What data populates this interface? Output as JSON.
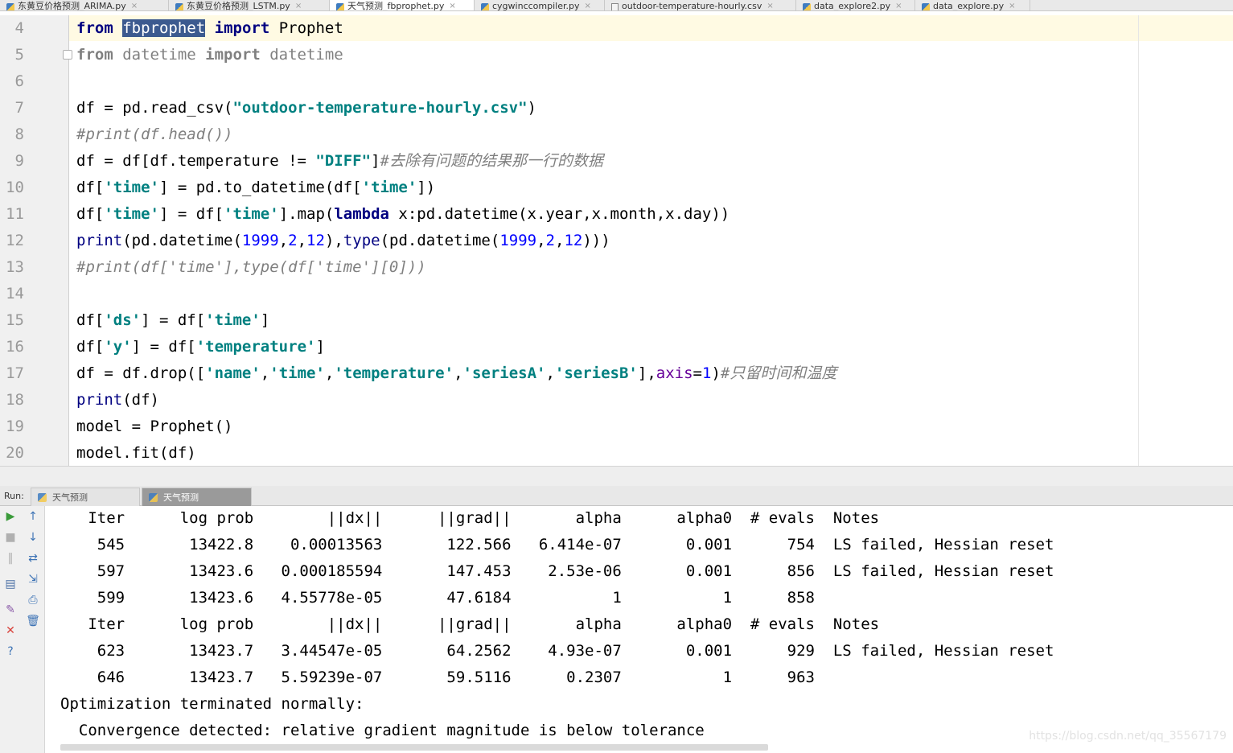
{
  "tabs": [
    {
      "label": "东黄豆价格预测_ARIMA.py",
      "icon": "python-file-icon",
      "active": false
    },
    {
      "label": "东黄豆价格预测_LSTM.py",
      "icon": "python-file-icon",
      "active": false
    },
    {
      "label": "天气预测_fbprophet.py",
      "icon": "python-file-icon",
      "active": true
    },
    {
      "label": "cygwinccompiler.py",
      "icon": "python-file-icon",
      "active": false
    },
    {
      "label": "outdoor-temperature-hourly.csv",
      "icon": "csv-file-icon",
      "active": false
    },
    {
      "label": "data_explore2.py",
      "icon": "python-file-icon",
      "active": false
    },
    {
      "label": "data_explore.py",
      "icon": "python-file-icon",
      "active": false
    }
  ],
  "tab_close_glyph": "×",
  "editor": {
    "caret_line": "4",
    "lines": [
      {
        "n": "4",
        "t": [
          [
            "from",
            "kw"
          ],
          [
            " ",
            ""
          ],
          [
            "fbprophet",
            "sel"
          ],
          [
            " ",
            ""
          ],
          [
            "import",
            "kw"
          ],
          [
            " Prophet",
            ""
          ]
        ]
      },
      {
        "n": "5",
        "fold": true,
        "t": [
          [
            "from",
            "unused-kw"
          ],
          [
            " datetime ",
            "unused"
          ],
          [
            "import",
            "unused-kw"
          ],
          [
            " datetime",
            "unused"
          ]
        ]
      },
      {
        "n": "6",
        "t": []
      },
      {
        "n": "7",
        "t": [
          [
            "df = pd.read_csv(",
            ""
          ],
          [
            "\"outdoor-temperature-hourly.csv\"",
            "str"
          ],
          [
            ")",
            ""
          ]
        ]
      },
      {
        "n": "8",
        "t": [
          [
            "#print(df.head())",
            "cmt"
          ]
        ]
      },
      {
        "n": "9",
        "t": [
          [
            "df = df[df.temperature != ",
            ""
          ],
          [
            "\"DIFF\"",
            "str"
          ],
          [
            "]",
            ""
          ],
          [
            "#去除有问题的结果那一行的数据",
            "cmt"
          ]
        ]
      },
      {
        "n": "10",
        "t": [
          [
            "df[",
            ""
          ],
          [
            "'time'",
            "str"
          ],
          [
            "] = pd.to_datetime(df[",
            ""
          ],
          [
            "'time'",
            "str"
          ],
          [
            "])",
            ""
          ]
        ]
      },
      {
        "n": "11",
        "t": [
          [
            "df[",
            ""
          ],
          [
            "'time'",
            "str"
          ],
          [
            "] = df[",
            ""
          ],
          [
            "'time'",
            "str"
          ],
          [
            "].map(",
            ""
          ],
          [
            "lambda",
            "kw"
          ],
          [
            " x:pd.datetime(x.year,x.month,x.day))",
            ""
          ]
        ]
      },
      {
        "n": "12",
        "t": [
          [
            "print",
            "bi"
          ],
          [
            "(pd.datetime(",
            ""
          ],
          [
            "1999",
            "num"
          ],
          [
            ",",
            ""
          ],
          [
            "2",
            "num"
          ],
          [
            ",",
            ""
          ],
          [
            "12",
            "num"
          ],
          [
            "),",
            ""
          ],
          [
            "type",
            "bi"
          ],
          [
            "(pd.datetime(",
            ""
          ],
          [
            "1999",
            "num"
          ],
          [
            ",",
            ""
          ],
          [
            "2",
            "num"
          ],
          [
            ",",
            ""
          ],
          [
            "12",
            "num"
          ],
          [
            ")))",
            ""
          ]
        ]
      },
      {
        "n": "13",
        "t": [
          [
            "#print(df['time'],type(df['time'][0]))",
            "cmt"
          ]
        ]
      },
      {
        "n": "14",
        "t": []
      },
      {
        "n": "15",
        "t": [
          [
            "df[",
            ""
          ],
          [
            "'ds'",
            "str"
          ],
          [
            "] = df[",
            ""
          ],
          [
            "'time'",
            "str"
          ],
          [
            "]",
            ""
          ]
        ]
      },
      {
        "n": "16",
        "t": [
          [
            "df[",
            ""
          ],
          [
            "'y'",
            "str"
          ],
          [
            "] = df[",
            ""
          ],
          [
            "'temperature'",
            "str"
          ],
          [
            "]",
            ""
          ]
        ]
      },
      {
        "n": "17",
        "t": [
          [
            "df = df.drop([",
            ""
          ],
          [
            "'name'",
            "str"
          ],
          [
            ",",
            ""
          ],
          [
            "'time'",
            "str"
          ],
          [
            ",",
            ""
          ],
          [
            "'temperature'",
            "str"
          ],
          [
            ",",
            ""
          ],
          [
            "'seriesA'",
            "str"
          ],
          [
            ",",
            ""
          ],
          [
            "'seriesB'",
            "str"
          ],
          [
            "],",
            ""
          ],
          [
            "axis",
            "kwa"
          ],
          [
            "=",
            ""
          ],
          [
            "1",
            "num"
          ],
          [
            ")",
            ""
          ],
          [
            "#只留时间和温度",
            "cmt"
          ]
        ]
      },
      {
        "n": "18",
        "t": [
          [
            "print",
            "bi"
          ],
          [
            "(df)",
            ""
          ]
        ]
      },
      {
        "n": "19",
        "t": [
          [
            "model = Prophet()",
            ""
          ]
        ]
      },
      {
        "n": "20",
        "t": [
          [
            "model.fit(df)",
            ""
          ]
        ]
      }
    ]
  },
  "run_panel": {
    "label": "Run:",
    "tabs": [
      {
        "label": "天气预测_fbprophet",
        "active": false
      },
      {
        "label": "天气预测_fbprophet",
        "active": true
      }
    ],
    "toolbar": [
      {
        "name": "rerun-icon",
        "glyph": "▶",
        "color": "#3a9b3a"
      },
      {
        "name": "scroll-up-icon",
        "glyph": "↑",
        "color": "#3d73b5"
      },
      {
        "name": "stop-icon",
        "glyph": "■",
        "color": "#b0b0b0"
      },
      {
        "name": "scroll-down-icon",
        "glyph": "↓",
        "color": "#3d73b5"
      },
      {
        "name": "pause-icon",
        "glyph": "‖",
        "color": "#b0b0b0"
      },
      {
        "name": "soft-wrap-icon",
        "glyph": "⇄",
        "color": "#3d73b5"
      },
      {
        "name": "layout-icon",
        "glyph": "▤",
        "color": "#4a6fa5"
      },
      {
        "name": "scroll-to-end-icon",
        "glyph": "⇲",
        "color": "#3d73b5"
      },
      {
        "name": "print-icon",
        "glyph": "⎙",
        "color": "#3d73b5"
      },
      {
        "name": "pin-icon",
        "glyph": "✎",
        "color": "#8a5aa8"
      },
      {
        "name": "clear-icon",
        "glyph": "🗑",
        "color": "#3d73b5"
      },
      {
        "name": "close-icon",
        "glyph": "✕",
        "color": "#d9423b"
      },
      {
        "name": "help-icon",
        "glyph": "?",
        "color": "#3d73b5"
      }
    ],
    "console_lines": [
      "   Iter      log prob        ||dx||      ||grad||       alpha      alpha0  # evals  Notes",
      "    545       13422.8    0.00013563       122.566   6.414e-07       0.001      754  LS failed, Hessian reset",
      "    597       13423.6   0.000185594       147.453    2.53e-06       0.001      856  LS failed, Hessian reset",
      "    599       13423.6   4.55778e-05       47.6184           1           1      858",
      "   Iter      log prob        ||dx||      ||grad||       alpha      alpha0  # evals  Notes",
      "    623       13423.7   3.44547e-05       64.2562    4.93e-07       0.001      929  LS failed, Hessian reset",
      "    646       13423.7   5.59239e-07       59.5116      0.2307           1      963",
      "Optimization terminated normally:",
      "  Convergence detected: relative gradient magnitude is below tolerance"
    ],
    "watermark": "https://blog.csdn.net/qq_35567179"
  }
}
